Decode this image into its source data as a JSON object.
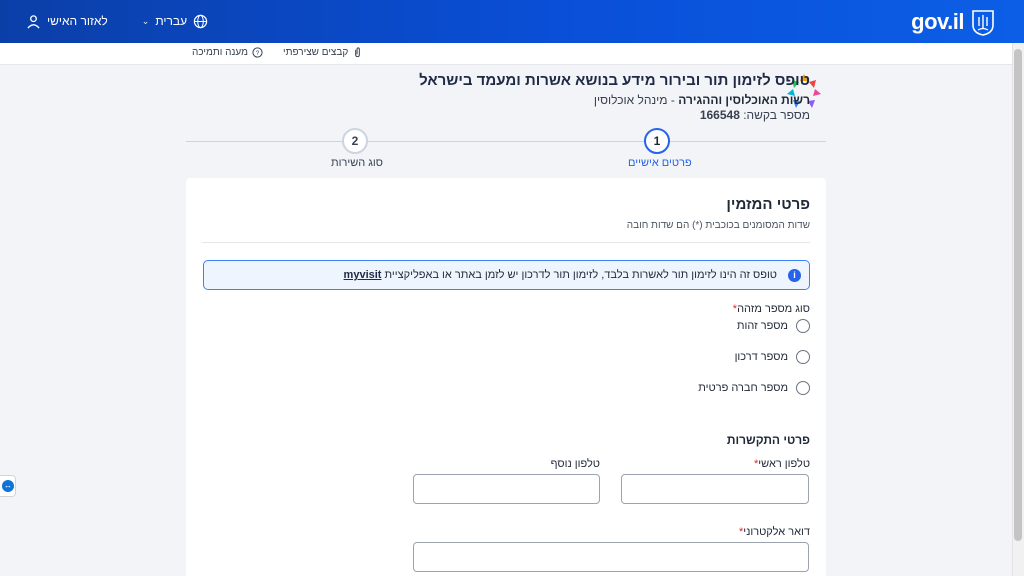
{
  "topbar": {
    "logo_text": "gov.il",
    "language": "עברית",
    "personal_area": "לאזור האישי"
  },
  "utilbar": {
    "attachments": "קבצים שצירפתי",
    "help": "מענה ותמיכה"
  },
  "header": {
    "title": "טופס לזימון תור ובירור מידע בנושא אשרות ומעמד בישראל",
    "authority": "רשות האוכלוסין וההגירה",
    "department": "- מינהל אוכלוסין",
    "request_label": "מספר בקשה:",
    "request_number": "166548"
  },
  "stepper": {
    "steps": [
      {
        "number": "1",
        "label": "פרטים אישיים",
        "active": true
      },
      {
        "number": "2",
        "label": "סוג השירות",
        "active": false
      }
    ]
  },
  "form": {
    "title": "פרטי המזמין",
    "required_note": "שדות המסומנים בכוכבית (*) הם שדות חובה",
    "alert_text": "טופס זה הינו לזימון תור לאשרות בלבד, לזימון תור לדרכון יש לזמן באתר או באפליקציית",
    "alert_link": "myvisit",
    "id_type_label": "סוג מספר מזהה",
    "id_type_options": [
      "מספר זהות",
      "מספר דרכון",
      "מספר חברה פרטית"
    ],
    "contact_title": "פרטי התקשרות",
    "main_phone_label": "טלפון ראשי",
    "extra_phone_label": "טלפון נוסף",
    "email_label": "דואר אלקטרוני",
    "required_mark": "*"
  },
  "colors": {
    "header_blue": "#0b3fa8",
    "accent": "#2563eb",
    "required": "#dc2626"
  }
}
